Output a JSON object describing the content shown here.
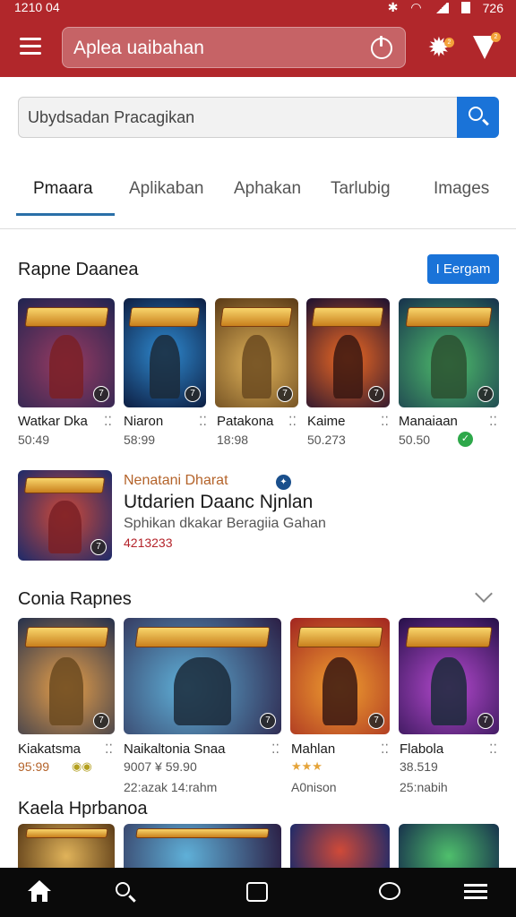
{
  "status_bar": {
    "time": "1210 04",
    "right": "726"
  },
  "header": {
    "search_text": "Aplea uaibahan",
    "notify_gear": "2",
    "notify_filter": "2",
    "brand_color": "#b1272b"
  },
  "search": {
    "placeholder": "Ubydsadan Pracagikan"
  },
  "tabs": [
    {
      "label": "Pmaara",
      "active": true
    },
    {
      "label": "Aplikaban"
    },
    {
      "label": "Aphakan"
    },
    {
      "label": "Tarlubig"
    },
    {
      "label": "Images"
    }
  ],
  "section1": {
    "title": "Rapne Daanea",
    "more_label": "I Eergam",
    "games": [
      {
        "name": "Watkar Dka",
        "price": "50:49",
        "badge": "7"
      },
      {
        "name": "Niaron",
        "price": "58:99",
        "badge": "7"
      },
      {
        "name": "Patakona",
        "price": "18:98",
        "badge": "7"
      },
      {
        "name": "Kaime",
        "price": "50.273",
        "badge": "7"
      },
      {
        "name": "Manaiaan",
        "price": "50.50",
        "badge": "7"
      }
    ]
  },
  "featured": {
    "tag": "Nenatani Dharat",
    "title": "Utdarien Daanc Njnlan",
    "subtitle": "Sphikan dkakar Beragiia Gahan",
    "price": "4213233",
    "badge": "7"
  },
  "section2": {
    "title": "Conia Rapnes",
    "games": [
      {
        "name": "Kiakatsma",
        "price": "95:99",
        "extra": "",
        "badge": "7"
      },
      {
        "name": "Naikaltonia Snaa",
        "price": "9007 ¥ 59.90",
        "extra": "22:azak 14:rahm",
        "badge": "7"
      },
      {
        "name": "Mahlan",
        "price": "★★★",
        "extra": "A0nison",
        "badge": "7"
      },
      {
        "name": "Flabola",
        "price": "38.519",
        "extra": "25:nabih",
        "badge": "7"
      }
    ]
  },
  "section3": {
    "title": "Kaela Hprbanoa"
  },
  "icons": {
    "menu": "hamburger-icon",
    "settings": "gear-icon",
    "filter": "filter-icon",
    "power": "power-icon",
    "search": "search-icon",
    "home": "home-icon",
    "nav_search": "search-icon",
    "square": "square-icon",
    "chat": "chat-icon",
    "more": "menu-icon"
  }
}
